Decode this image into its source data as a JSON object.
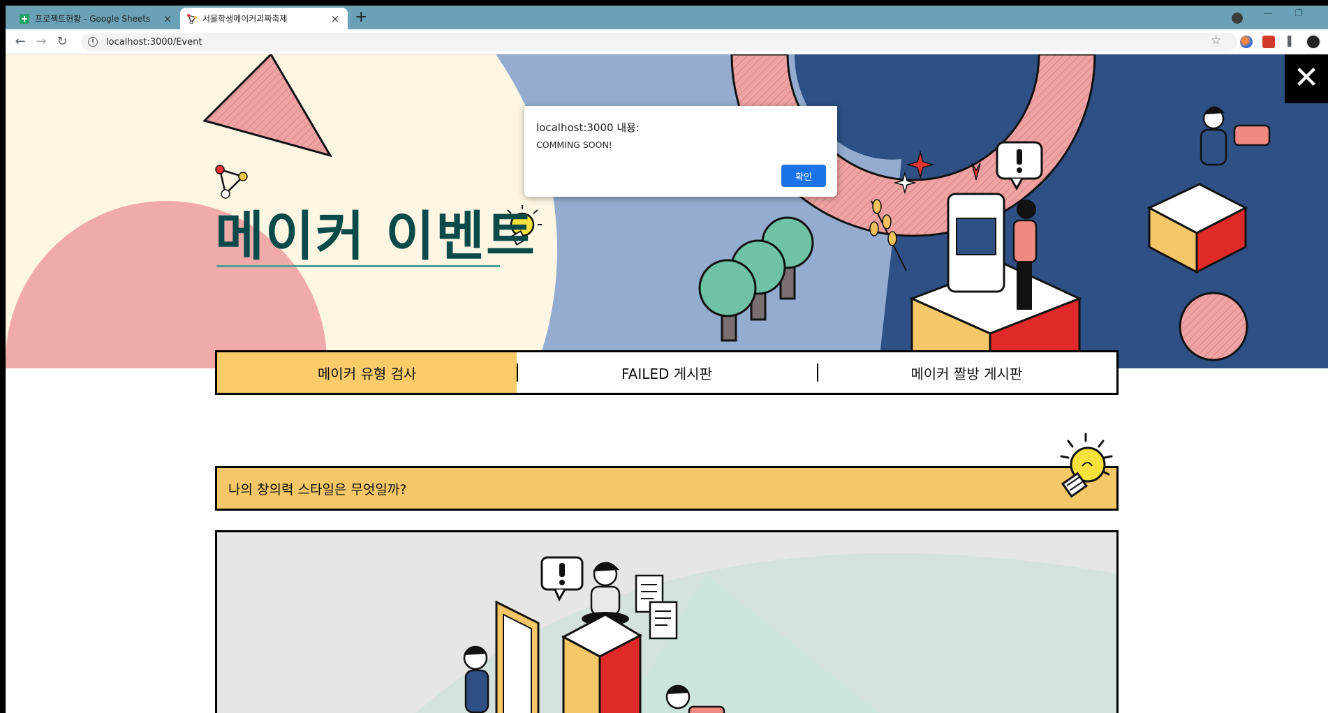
{
  "browser": {
    "tabs": [
      {
        "title": "프로젝트현황 - Google Sheets",
        "close": "×"
      },
      {
        "title": "서울학생메이커괴짜축제",
        "close": "×"
      }
    ],
    "new_tab": "+",
    "url": "localhost:3000/Event",
    "icons": [
      "back-icon",
      "forward-icon",
      "reload-icon",
      "info-icon",
      "star-icon",
      "puzzle-icon"
    ]
  },
  "page": {
    "title": "메이커 이벤트",
    "close_symbol": "✕",
    "event_tabs": [
      {
        "label": "메이커 유형 검사",
        "active": true
      },
      {
        "label": "FAILED 게시판",
        "active": false
      },
      {
        "label": "메이커 짤방 게시판",
        "active": false
      }
    ],
    "question": "나의 창의력 스타일은 무엇일까?"
  },
  "alert": {
    "title": "localhost:3000 내용:",
    "message": "COMMING SOON!",
    "ok_label": "확인"
  },
  "colors": {
    "hero_navy": "#2e5085",
    "hero_cream": "#fdf6e3",
    "hero_pink": "#f1a9a9",
    "title_teal": "#0b4a4a",
    "tab_active": "#fccc6a",
    "question_bg": "#f4c768",
    "button_blue": "#1a73e8"
  }
}
